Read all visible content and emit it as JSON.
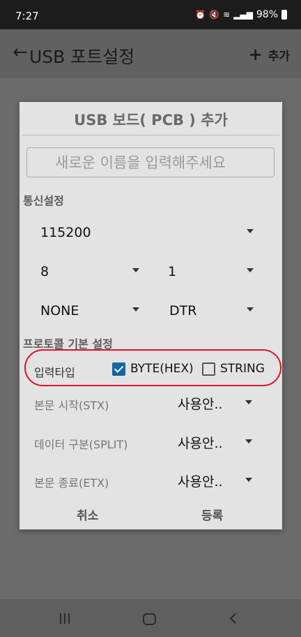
{
  "status_bar": {
    "time": "7:27",
    "battery": "98%",
    "icons": [
      "alarm-icon",
      "mute-icon",
      "wifi-icon",
      "signal-icon",
      "battery-icon"
    ]
  },
  "app_bar": {
    "title": "USB 포트설정",
    "add_label": "추가",
    "back_icon": "arrow-left-icon",
    "add_icon": "plus-icon"
  },
  "dialog": {
    "title": "USB 보드( PCB ) 추가",
    "name_placeholder": "새로운 이름을 입력해주세요",
    "comm_section": "통신설정",
    "baud_rate": "115200",
    "data_bits": "8",
    "stop_bits": "1",
    "parity": "NONE",
    "flow_control": "DTR",
    "protocol_section": "프로토콜 기본 설정",
    "input_type_label": "입력타입",
    "input_types": [
      {
        "label": "BYTE(HEX)",
        "checked": true
      },
      {
        "label": "STRING",
        "checked": false
      }
    ],
    "rows": [
      {
        "label": "본문 시작(STX)",
        "value": "사용안.."
      },
      {
        "label": "데이터 구분(SPLIT)",
        "value": "사용안.."
      },
      {
        "label": "본문 종료(ETX)",
        "value": "사용안.."
      }
    ],
    "cancel_label": "취소",
    "register_label": "등록"
  },
  "colors": {
    "checkbox_accent": "#1565a0",
    "highlight_oval": "#e0102a",
    "dialog_bg": "#e3e3e3",
    "scrim": "#6b6b6b"
  }
}
